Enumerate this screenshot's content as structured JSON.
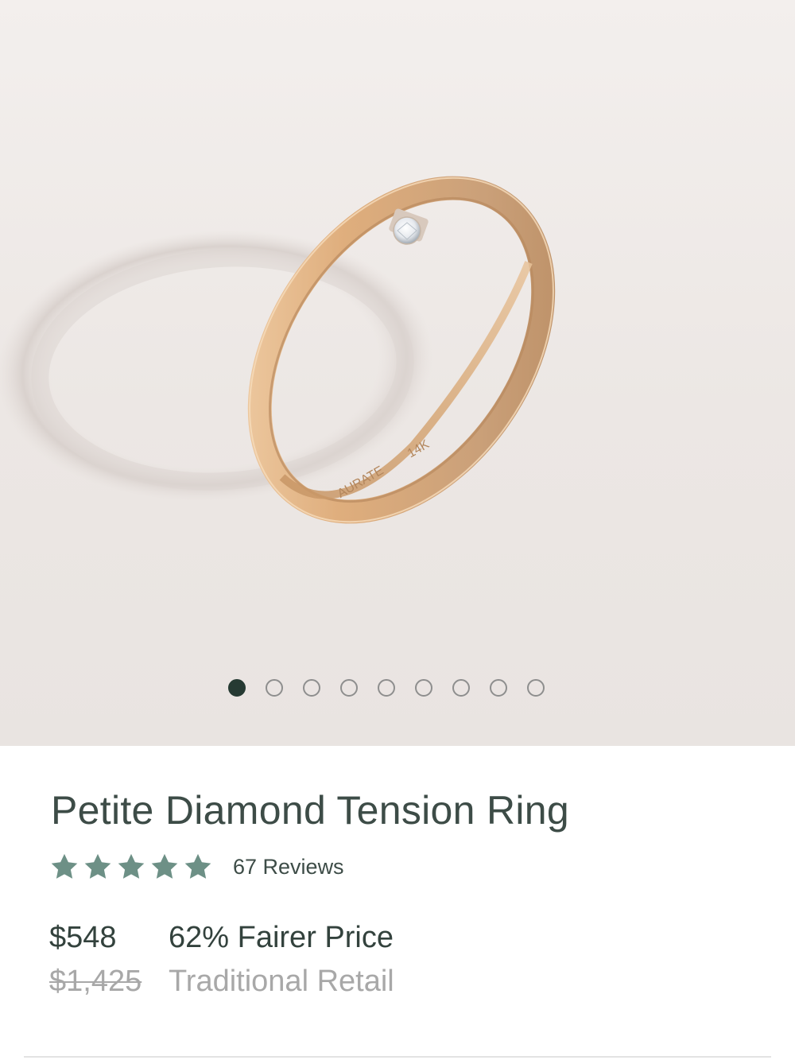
{
  "gallery": {
    "image_alt": "Petite Diamond Tension Ring in rose gold",
    "ring_engraving_brand": "AURATE",
    "ring_engraving_karat": "14K",
    "dots_total": 9,
    "active_index": 0
  },
  "product": {
    "title": "Petite Diamond Tension Ring",
    "rating": 5,
    "reviews_label": "67 Reviews",
    "price": "$548",
    "discount_label": "62% Fairer Price",
    "original_price": "$1,425",
    "original_label": "Traditional Retail"
  },
  "colors": {
    "accent_star": "#6d9086",
    "text_primary": "#3d4c47",
    "text_muted": "#a8a8a8",
    "dot_active": "#263a33"
  }
}
